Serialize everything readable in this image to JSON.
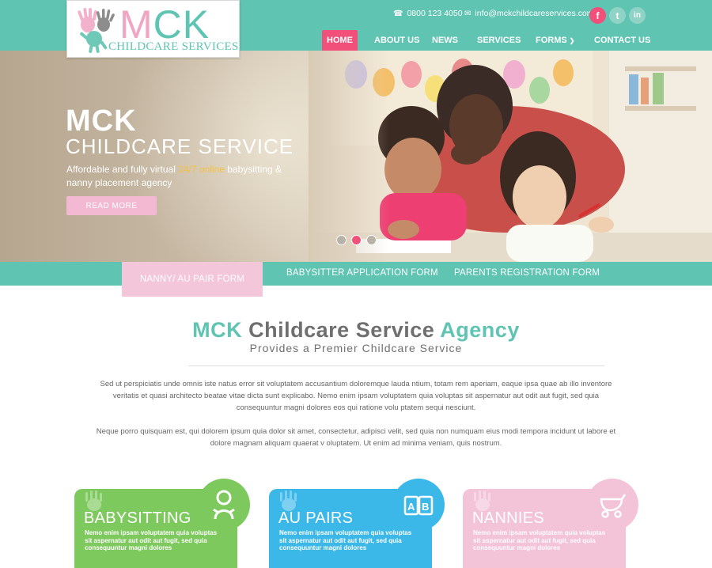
{
  "logo": {
    "brand_m": "M",
    "brand_ck": "CK",
    "subtitle": "CHILDCARE SERVICES"
  },
  "header": {
    "phone": "0800 123 4050",
    "email": "info@mckchildcareservices.com",
    "social": {
      "facebook": "f",
      "twitter": "t",
      "linkedin": "in"
    }
  },
  "nav": {
    "items": [
      {
        "label": "HOME"
      },
      {
        "label": "ABOUT US"
      },
      {
        "label": "NEWS"
      },
      {
        "label": "SERVICES"
      },
      {
        "label": "FORMS"
      },
      {
        "label": "CONTACT US"
      }
    ]
  },
  "hero": {
    "title1": "MCK",
    "title2": "CHILDCARE SERVICE",
    "text_before": "Affordable and fully virtual ",
    "text_highlight": "24/7 online",
    "text_after": " babysitting & nanny placement agency",
    "button": "READ MORE"
  },
  "tabs": [
    {
      "label": "NANNY/ AU PAIR FORM"
    },
    {
      "label": "BABYSITTER APPLICATION FORM"
    },
    {
      "label": "PARENTS REGISTRATION FORM"
    }
  ],
  "main": {
    "heading_a": "MCK",
    "heading_b": "Childcare Service",
    "heading_c": "Agency",
    "subheading": "Provides a Premier Childcare Service",
    "para1": "Sed ut perspiciatis unde omnis iste natus error sit voluptatem accusantium doloremque lauda ntium, totam rem aperiam, eaque ipsa quae ab illo inventore veritatis et quasi architecto beatae vitae dicta sunt explicabo.  Nemo enim ipsam voluptatem quia voluptas sit aspernatur aut odit aut fugit, sed quia consequuntur magni dolores eos qui ratione volu ptatem sequi nesciunt.",
    "para2": "Neque porro quisquam est, qui dolorem ipsum quia dolor sit amet, consectetur, adipisci velit, sed quia non numquam eius modi tempora incidunt ut labore et dolore magnam aliquam quaerat v oluptatem. Ut enim ad minima veniam, quis nostrum."
  },
  "cards": [
    {
      "title": "BABYSITTING",
      "icon": "baby-icon",
      "text": "Nemo enim ipsam voluptatem quia voluptas sit aspernatur aut odit aut fugit, sed quia consequuntur magni dolores"
    },
    {
      "title": "AU PAIRS",
      "icon": "abc-blocks-icon",
      "text": "Nemo enim ipsam voluptatem quia voluptas sit aspernatur aut odit aut fugit, sed quia consequuntur magni dolores"
    },
    {
      "title": "NANNIES",
      "icon": "pram-icon",
      "text": "Nemo enim ipsam voluptatem quia voluptas sit aspernatur aut odit aut fugit, sed quia consequuntur magni dolores"
    }
  ],
  "colors": {
    "teal": "#5fc4b2",
    "pink": "#f0507a",
    "light_pink": "#f3c3d8",
    "green": "#7dc95d",
    "blue": "#3bb8e8",
    "highlight": "#f5c242"
  }
}
